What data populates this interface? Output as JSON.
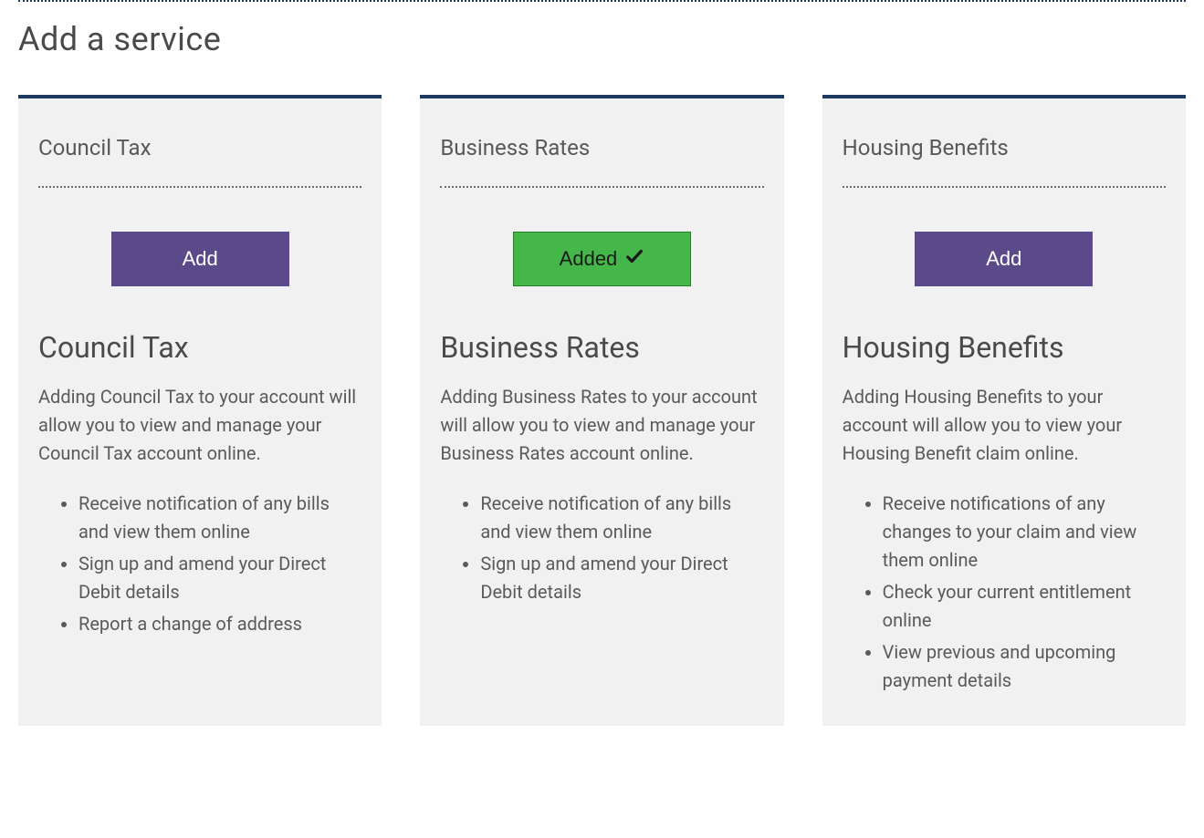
{
  "page_title": "Add a service",
  "colors": {
    "accent_purple": "#5a4a8a",
    "accent_green": "#45b649",
    "border_navy": "#1f3a5f"
  },
  "cards": [
    {
      "small_title": "Council Tax",
      "status": "add",
      "button_label": "Add",
      "big_title": "Council Tax",
      "description": "Adding Council Tax to your account will allow you to view and manage your Council Tax account online.",
      "bullets": [
        "Receive notification of any bills and view them online",
        "Sign up and amend your Direct Debit details",
        "Report a change of address"
      ]
    },
    {
      "small_title": "Business Rates",
      "status": "added",
      "button_label": "Added",
      "big_title": "Business Rates",
      "description": "Adding Business Rates to your account will allow you to view and manage your Business Rates account online.",
      "bullets": [
        "Receive notification of any bills and view them online",
        "Sign up and amend your Direct Debit details"
      ]
    },
    {
      "small_title": "Housing Benefits",
      "status": "add",
      "button_label": "Add",
      "big_title": "Housing Benefits",
      "description": "Adding Housing Benefits to your account will allow you to view your Housing Benefit claim online.",
      "bullets": [
        "Receive notifications of any changes to your claim and view them online",
        "Check your current entitlement online",
        "View previous and upcoming payment details"
      ]
    }
  ]
}
